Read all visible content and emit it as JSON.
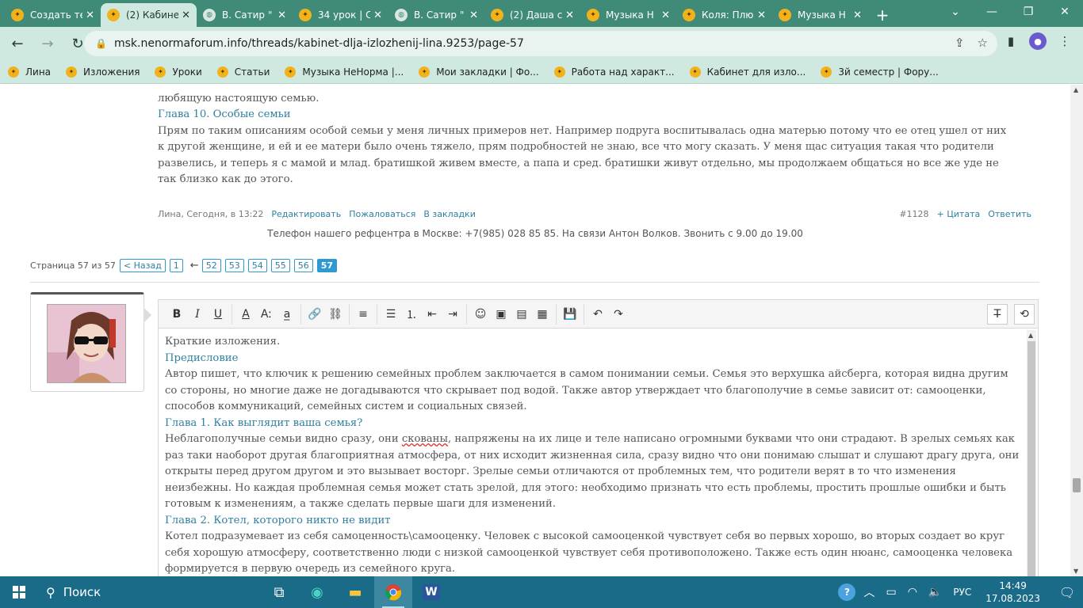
{
  "browser": {
    "tabs": [
      {
        "title": "Создать те",
        "icon": "forum-favicon"
      },
      {
        "title": "(2) Кабине",
        "icon": "forum-favicon",
        "active": true
      },
      {
        "title": "В. Сатир \"",
        "icon": "globe-icon"
      },
      {
        "title": "34 урок | С",
        "icon": "forum-favicon"
      },
      {
        "title": "В. Сатир \"",
        "icon": "globe-icon"
      },
      {
        "title": "(2) Даша с",
        "icon": "forum-favicon"
      },
      {
        "title": "Музыка Н",
        "icon": "forum-favicon"
      },
      {
        "title": "Коля: Плю",
        "icon": "forum-favicon"
      },
      {
        "title": "Музыка Н",
        "icon": "forum-favicon"
      }
    ],
    "url": "msk.nenormaforum.info/threads/kabinet-dlja-izlozhenij-lina.9253/page-57",
    "bookmarks": [
      "Лина",
      "Изложения",
      "Уроки",
      "Статьи",
      "Музыка НеНорма |...",
      "Мои закладки | Фо...",
      "Работа над характ...",
      "Кабинет для изло...",
      "3й семестр | Фору..."
    ]
  },
  "post": {
    "lines_top": [
      "любящую настоящую семью."
    ],
    "chapter10_heading": "Глава 10. Особые семьи",
    "chapter10_text": "Прям по таким описаниям особой семьи у меня личных примеров нет. Например подруга воспитывалась одна матерью потому что ее отец ушел от них к другой женщине, и ей и ее матери было очень тяжело, прям подробностей не знаю, все что могу сказать. У меня щас ситуация такая что родители развелись, и теперь я с мамой и млад. братишкой живем вместе, а папа и сред. братишки живут отдельно, мы продолжаем общаться но все же уде не так близко как до этого.",
    "meta": {
      "author_time": "Лина, Сегодня, в 13:22",
      "edit": "Редактировать",
      "report": "Пожаловаться",
      "bookmark": "В закладки",
      "number": "#1128",
      "quote": "+ Цитата",
      "reply": "Ответить"
    }
  },
  "phone_notice": "Телефон нашего рефцентра в Москве: +7(985) 028 85 85. На связи Антон Волков. Звонить с 9.00 до 19.00",
  "pagination": {
    "label": "Страница 57 из 57",
    "back": "< Назад",
    "first": "1",
    "arrow": "←",
    "pages": [
      "52",
      "53",
      "54",
      "55",
      "56"
    ],
    "current": "57"
  },
  "editor": {
    "title_line": "Краткие изложения.",
    "preface_heading": "Предисловие",
    "preface_text": "Автор пишет, что ключик к решению семейных проблем заключается в самом понимании семьи. Семья это верхушка айсберга, которая видна другим со стороны, но многие даже не догадываются что скрывает под водой. Также автор утверждает что благополучие в семье зависит от: самооценки, способов коммуникаций, семейных систем и социальных связей.",
    "ch1_heading": "Глава 1. Как выглядит ваша семья?",
    "ch1_text_a": "Неблагополучные семьи видно сразу, они ",
    "ch1_spell": "скованы",
    "ch1_text_b": ", напряжены на их лице и теле написано огромными буквами что они страдают. В зрелых семьях как раз таки наоборот другая благоприятная атмосфера, от них исходит жизненная сила, сразу видно что они понимаю слышат и слушают драгу друга, они открыты перед другом другом и это вызывает восторг. Зрелые семьи отличаются от проблемных тем, что родители верят в то что изменения неизбежны. Но каждая проблемная семья может стать зрелой, для этого: необходимо признать что есть проблемы, простить прошлые ошибки и быть готовым к изменениям, а также сделать первые шаги для изменений.",
    "ch2_heading": "Глава 2. Котел, которого никто не видит",
    "ch2_text": "Котел подразумевает из себя самоценность\\самооценку. Человек с высокой самооценкой чувствует себя во первых хорошо, во вторых создает во круг себя хорошую атмосферу, соответственно люди с низкой самооценкой чувствует себя противоположено. Также есть один нюанс, самооценка человека формируется в первую очередь из семейного круга."
  },
  "taskbar": {
    "search_placeholder": "Поиск",
    "lang": "РУС",
    "time": "14:49",
    "date": "17.08.2023"
  }
}
